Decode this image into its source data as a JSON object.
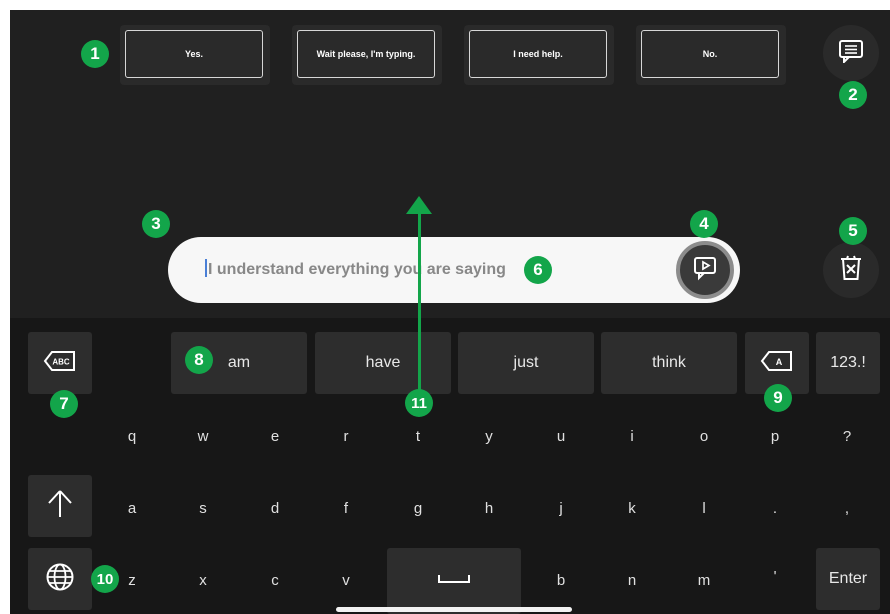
{
  "phrases": [
    "Yes.",
    "Wait please, I'm typing.",
    "I need help.",
    "No."
  ],
  "input": {
    "text": "I understand everything you are saying"
  },
  "suggestions": [
    "am",
    "have",
    "just",
    "think"
  ],
  "keys": {
    "mode": "123.!",
    "row1": [
      "q",
      "w",
      "e",
      "r",
      "t",
      "y",
      "u",
      "i",
      "o",
      "p",
      "?"
    ],
    "row2": [
      "a",
      "s",
      "d",
      "f",
      "g",
      "h",
      "j",
      "k",
      "l",
      ".",
      ","
    ],
    "row3_left": [
      "z",
      "x",
      "c",
      "v"
    ],
    "row3_right": [
      "b",
      "n",
      "m",
      "'"
    ],
    "enter": "Enter"
  },
  "badges": [
    "1",
    "2",
    "3",
    "4",
    "5",
    "6",
    "7",
    "8",
    "9",
    "10",
    "11"
  ],
  "colors": {
    "accent": "#13a54a",
    "background": "#202020",
    "keyboard": "#171717",
    "key": "#2d2d2d"
  },
  "icons": {
    "quick_phrases": "message-icon",
    "speak": "play-speech-icon",
    "clear": "trash-clear-icon",
    "delete_word": "backspace-abc-icon",
    "delete_char": "backspace-a-icon",
    "shift": "shift-arrow-icon",
    "language": "globe-icon"
  }
}
